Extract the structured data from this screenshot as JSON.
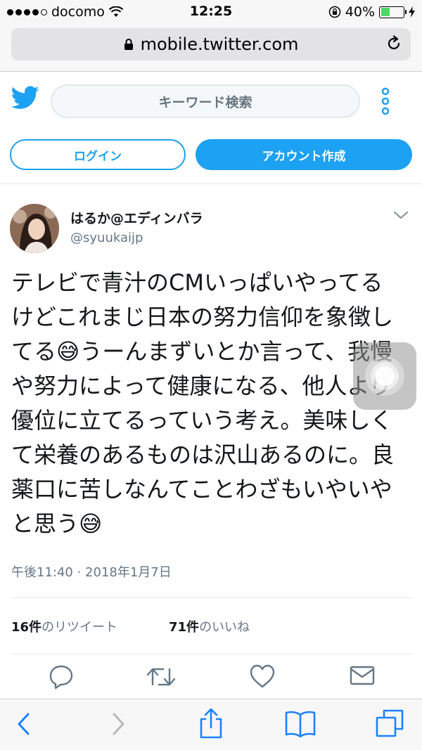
{
  "status_bar": {
    "carrier": "docomo",
    "time": "12:25",
    "battery_percent": "40%",
    "battery_level": 0.4,
    "icons": [
      "signal-dots",
      "wifi-icon",
      "orientation-lock-icon",
      "battery-icon",
      "charging-icon"
    ]
  },
  "browser": {
    "url": "mobile.twitter.com",
    "icons": [
      "lock-icon",
      "reload-icon"
    ]
  },
  "header": {
    "search_placeholder": "キーワード検索",
    "login_label": "ログイン",
    "signup_label": "アカウント作成",
    "accent_color": "#1da1f2",
    "icons": [
      "twitter-bird-icon",
      "more-vertical-icon"
    ]
  },
  "tweet": {
    "display_name": "はるか@エディンバラ",
    "handle": "@syuukaijp",
    "text_part1": "テレビで青汁のCMいっぱいやってるけどこれまじ日本の努力信仰を象徴してる",
    "text_part2": "うーんまずいとか言って、我慢や努力によって健康になる、他人より優位に立てるっていう考え。美味しくて栄養のあるものは沢山あるのに。良薬口に苦しなんてことわざもいやいやと思う",
    "emoji": "😅",
    "timestamp": "午後11:40 · 2018年1月7日",
    "retweet_count": "16件",
    "retweet_label": "のリツイート",
    "like_count": "71件",
    "like_label": "のいいね"
  },
  "actions": [
    "reply-icon",
    "retweet-icon",
    "like-icon",
    "message-icon"
  ],
  "safari_toolbar": [
    "back-icon",
    "forward-icon",
    "share-icon",
    "bookmarks-icon",
    "tabs-icon"
  ]
}
